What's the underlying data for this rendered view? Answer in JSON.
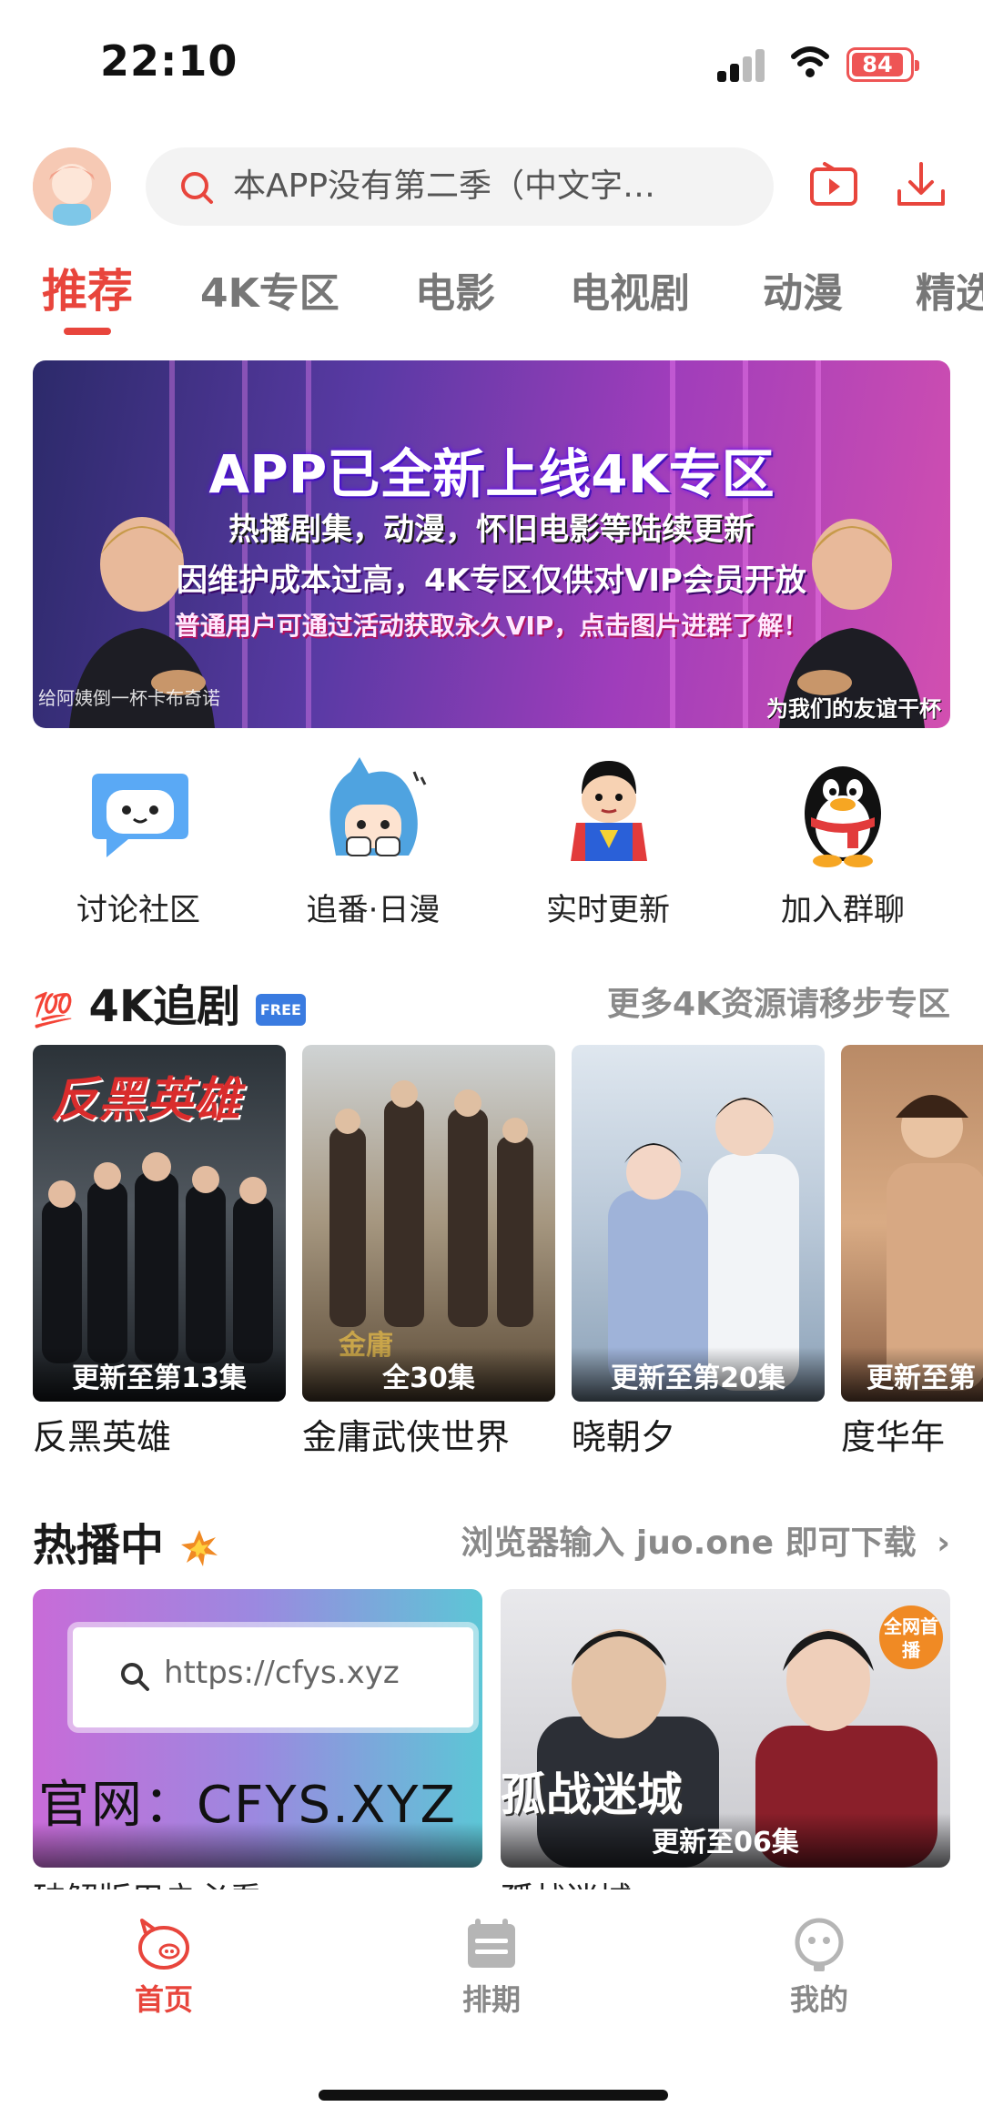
{
  "status_bar": {
    "time": "22:10",
    "battery": "84"
  },
  "header": {
    "search_placeholder": "本APP没有第二季（中文字…"
  },
  "tabs": [
    {
      "label": "推荐",
      "active": true
    },
    {
      "label": "4K专区"
    },
    {
      "label": "电影"
    },
    {
      "label": "电视剧"
    },
    {
      "label": "动漫"
    },
    {
      "label": "精选"
    }
  ],
  "banner": {
    "title": "APP已全新上线4K专区",
    "line1": "热播剧集，动漫，怀旧电影等陆续更新",
    "line2": "因维护成本过高，4K专区仅供对VIP会员开放",
    "line3": "普通用户可通过活动获取永久VIP，点击图片进群了解！",
    "caption_left": "给阿姨倒一杯卡布奇诺",
    "caption_right": "为我们的友谊干杯"
  },
  "quick_links": [
    {
      "label": "讨论社区",
      "icon": "chat-bubble-icon"
    },
    {
      "label": "追番·日漫",
      "icon": "anime-character-icon"
    },
    {
      "label": "实时更新",
      "icon": "superman-icon"
    },
    {
      "label": "加入群聊",
      "icon": "qq-penguin-icon"
    }
  ],
  "section_4k": {
    "emoji": "💯",
    "title": "4K追剧",
    "badge": "FREE",
    "more": "更多4K资源请移步专区"
  },
  "posters": [
    {
      "title": "反黑英雄",
      "badge": "更新至第13集",
      "art_text": "反黑英雄"
    },
    {
      "title": "金庸武侠世界",
      "badge": "全30集"
    },
    {
      "title": "晓朝夕",
      "badge": "更新至第20集"
    },
    {
      "title": "度华年",
      "badge": "更新至第"
    }
  ],
  "section_hot": {
    "title": "热播中",
    "more": "浏览器输入 juo.one 即可下载",
    "chevron": "›"
  },
  "hot_cards": [
    {
      "title": "破解版用户必看",
      "url_text": "https://cfys.xyz",
      "overlay_text": "官网：CFYS.XYZ"
    },
    {
      "title": "孤战迷城",
      "badge": "更新至06集",
      "art_text": "孤战迷城",
      "tag": "全网首播"
    }
  ],
  "bottom_nav": [
    {
      "label": "首页",
      "icon": "pig-home-icon",
      "active": true
    },
    {
      "label": "排期",
      "icon": "schedule-icon"
    },
    {
      "label": "我的",
      "icon": "profile-robot-icon"
    }
  ],
  "colors": {
    "accent": "#e8453c",
    "muted": "#8a8a8a"
  }
}
